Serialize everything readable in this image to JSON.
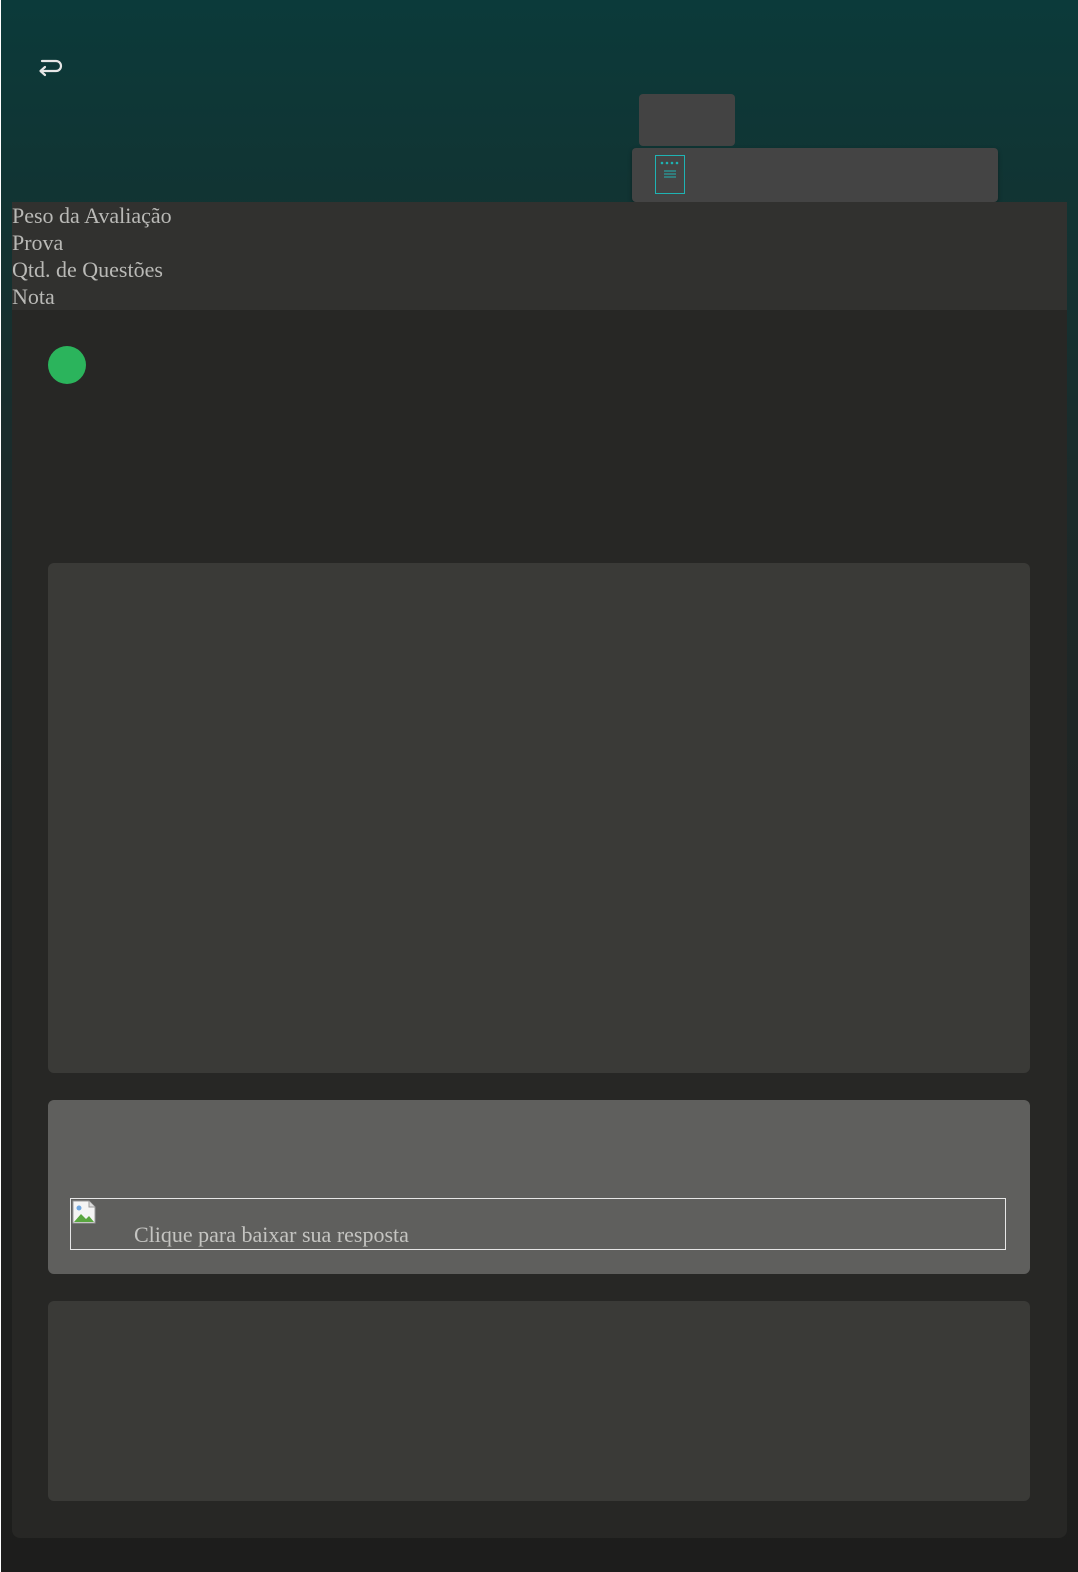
{
  "header": {
    "back_icon": "return-arrow-icon",
    "toolbar_icon": "document-icon"
  },
  "info": {
    "labels": [
      "Peso da Avaliação",
      "Prova",
      "Qtd. de Questões",
      "Nota"
    ]
  },
  "status": {
    "color": "#2bb45c"
  },
  "answer": {
    "download_label": "Clique para baixar sua resposta",
    "image_icon": "broken-image-icon"
  },
  "colors": {
    "header_bg": "#0b3a3a",
    "panel_bg": "#272725",
    "card_bg": "#3a3a37",
    "answer_card_bg": "#5f5f5d",
    "accent": "#1fb3b3"
  }
}
